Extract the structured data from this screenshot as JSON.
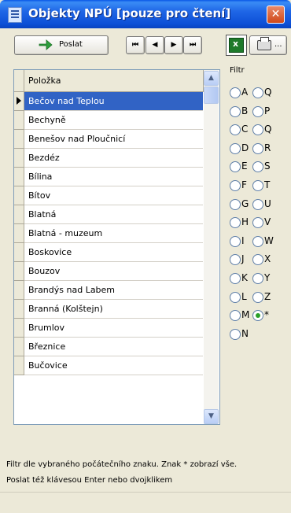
{
  "window": {
    "title": "Objekty NPÚ [pouze pro čtení]",
    "close_label": "✕"
  },
  "toolbar": {
    "send_label": "Poslat",
    "nav": [
      "first",
      "prev",
      "next",
      "last"
    ],
    "nav_glyphs": [
      "⏮",
      "◀",
      "▶",
      "⏭"
    ],
    "print_dots": "..."
  },
  "list": {
    "header": "Položka",
    "items": [
      "Bečov nad Teplou",
      "Bechyně",
      "Benešov nad Ploučnicí",
      "Bezdéz",
      "Bílina",
      "Bítov",
      "Blatná",
      "Blatná - muzeum",
      "Boskovice",
      "Bouzov",
      "Brandýs nad Labem",
      "Branná (Kolštejn)",
      "Brumlov",
      "Březnice",
      "Bučovice"
    ],
    "selected_index": 0
  },
  "filter": {
    "label": "Filtr",
    "left": [
      "A",
      "B",
      "C",
      "D",
      "E",
      "F",
      "G",
      "H",
      "I",
      "J",
      "K",
      "L",
      "M",
      "N"
    ],
    "right": [
      "Q",
      "P",
      "Q",
      "R",
      "S",
      "T",
      "U",
      "V",
      "W",
      "X",
      "Y",
      "Z",
      "*"
    ],
    "selected": "*"
  },
  "status": {
    "line1": "Filtr dle vybraného počátečního znaku. Znak * zobrazí vše.",
    "line2": "Poslat též klávesou Enter nebo dvojklikem"
  },
  "colors": {
    "title_bar": "#0c4fd6",
    "selection": "#3163c5",
    "close_button": "#d04818"
  }
}
